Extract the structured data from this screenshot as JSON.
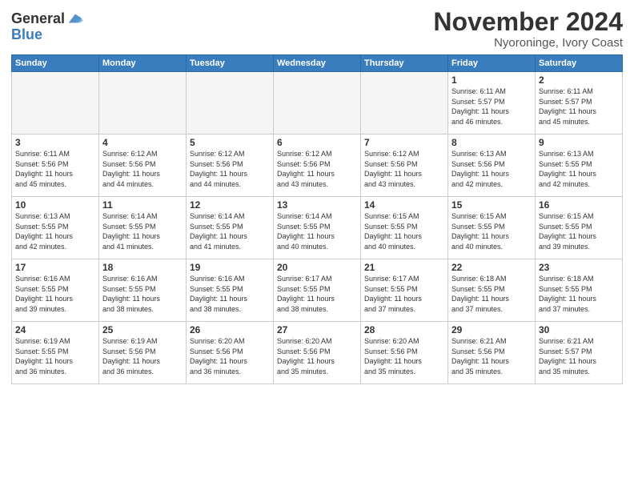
{
  "header": {
    "logo_line1": "General",
    "logo_line2": "Blue",
    "month": "November 2024",
    "location": "Nyoroninge, Ivory Coast"
  },
  "weekdays": [
    "Sunday",
    "Monday",
    "Tuesday",
    "Wednesday",
    "Thursday",
    "Friday",
    "Saturday"
  ],
  "weeks": [
    [
      {
        "day": "",
        "info": ""
      },
      {
        "day": "",
        "info": ""
      },
      {
        "day": "",
        "info": ""
      },
      {
        "day": "",
        "info": ""
      },
      {
        "day": "",
        "info": ""
      },
      {
        "day": "1",
        "info": "Sunrise: 6:11 AM\nSunset: 5:57 PM\nDaylight: 11 hours\nand 46 minutes."
      },
      {
        "day": "2",
        "info": "Sunrise: 6:11 AM\nSunset: 5:57 PM\nDaylight: 11 hours\nand 45 minutes."
      }
    ],
    [
      {
        "day": "3",
        "info": "Sunrise: 6:11 AM\nSunset: 5:56 PM\nDaylight: 11 hours\nand 45 minutes."
      },
      {
        "day": "4",
        "info": "Sunrise: 6:12 AM\nSunset: 5:56 PM\nDaylight: 11 hours\nand 44 minutes."
      },
      {
        "day": "5",
        "info": "Sunrise: 6:12 AM\nSunset: 5:56 PM\nDaylight: 11 hours\nand 44 minutes."
      },
      {
        "day": "6",
        "info": "Sunrise: 6:12 AM\nSunset: 5:56 PM\nDaylight: 11 hours\nand 43 minutes."
      },
      {
        "day": "7",
        "info": "Sunrise: 6:12 AM\nSunset: 5:56 PM\nDaylight: 11 hours\nand 43 minutes."
      },
      {
        "day": "8",
        "info": "Sunrise: 6:13 AM\nSunset: 5:56 PM\nDaylight: 11 hours\nand 42 minutes."
      },
      {
        "day": "9",
        "info": "Sunrise: 6:13 AM\nSunset: 5:55 PM\nDaylight: 11 hours\nand 42 minutes."
      }
    ],
    [
      {
        "day": "10",
        "info": "Sunrise: 6:13 AM\nSunset: 5:55 PM\nDaylight: 11 hours\nand 42 minutes."
      },
      {
        "day": "11",
        "info": "Sunrise: 6:14 AM\nSunset: 5:55 PM\nDaylight: 11 hours\nand 41 minutes."
      },
      {
        "day": "12",
        "info": "Sunrise: 6:14 AM\nSunset: 5:55 PM\nDaylight: 11 hours\nand 41 minutes."
      },
      {
        "day": "13",
        "info": "Sunrise: 6:14 AM\nSunset: 5:55 PM\nDaylight: 11 hours\nand 40 minutes."
      },
      {
        "day": "14",
        "info": "Sunrise: 6:15 AM\nSunset: 5:55 PM\nDaylight: 11 hours\nand 40 minutes."
      },
      {
        "day": "15",
        "info": "Sunrise: 6:15 AM\nSunset: 5:55 PM\nDaylight: 11 hours\nand 40 minutes."
      },
      {
        "day": "16",
        "info": "Sunrise: 6:15 AM\nSunset: 5:55 PM\nDaylight: 11 hours\nand 39 minutes."
      }
    ],
    [
      {
        "day": "17",
        "info": "Sunrise: 6:16 AM\nSunset: 5:55 PM\nDaylight: 11 hours\nand 39 minutes."
      },
      {
        "day": "18",
        "info": "Sunrise: 6:16 AM\nSunset: 5:55 PM\nDaylight: 11 hours\nand 38 minutes."
      },
      {
        "day": "19",
        "info": "Sunrise: 6:16 AM\nSunset: 5:55 PM\nDaylight: 11 hours\nand 38 minutes."
      },
      {
        "day": "20",
        "info": "Sunrise: 6:17 AM\nSunset: 5:55 PM\nDaylight: 11 hours\nand 38 minutes."
      },
      {
        "day": "21",
        "info": "Sunrise: 6:17 AM\nSunset: 5:55 PM\nDaylight: 11 hours\nand 37 minutes."
      },
      {
        "day": "22",
        "info": "Sunrise: 6:18 AM\nSunset: 5:55 PM\nDaylight: 11 hours\nand 37 minutes."
      },
      {
        "day": "23",
        "info": "Sunrise: 6:18 AM\nSunset: 5:55 PM\nDaylight: 11 hours\nand 37 minutes."
      }
    ],
    [
      {
        "day": "24",
        "info": "Sunrise: 6:19 AM\nSunset: 5:55 PM\nDaylight: 11 hours\nand 36 minutes."
      },
      {
        "day": "25",
        "info": "Sunrise: 6:19 AM\nSunset: 5:56 PM\nDaylight: 11 hours\nand 36 minutes."
      },
      {
        "day": "26",
        "info": "Sunrise: 6:20 AM\nSunset: 5:56 PM\nDaylight: 11 hours\nand 36 minutes."
      },
      {
        "day": "27",
        "info": "Sunrise: 6:20 AM\nSunset: 5:56 PM\nDaylight: 11 hours\nand 35 minutes."
      },
      {
        "day": "28",
        "info": "Sunrise: 6:20 AM\nSunset: 5:56 PM\nDaylight: 11 hours\nand 35 minutes."
      },
      {
        "day": "29",
        "info": "Sunrise: 6:21 AM\nSunset: 5:56 PM\nDaylight: 11 hours\nand 35 minutes."
      },
      {
        "day": "30",
        "info": "Sunrise: 6:21 AM\nSunset: 5:57 PM\nDaylight: 11 hours\nand 35 minutes."
      }
    ]
  ]
}
